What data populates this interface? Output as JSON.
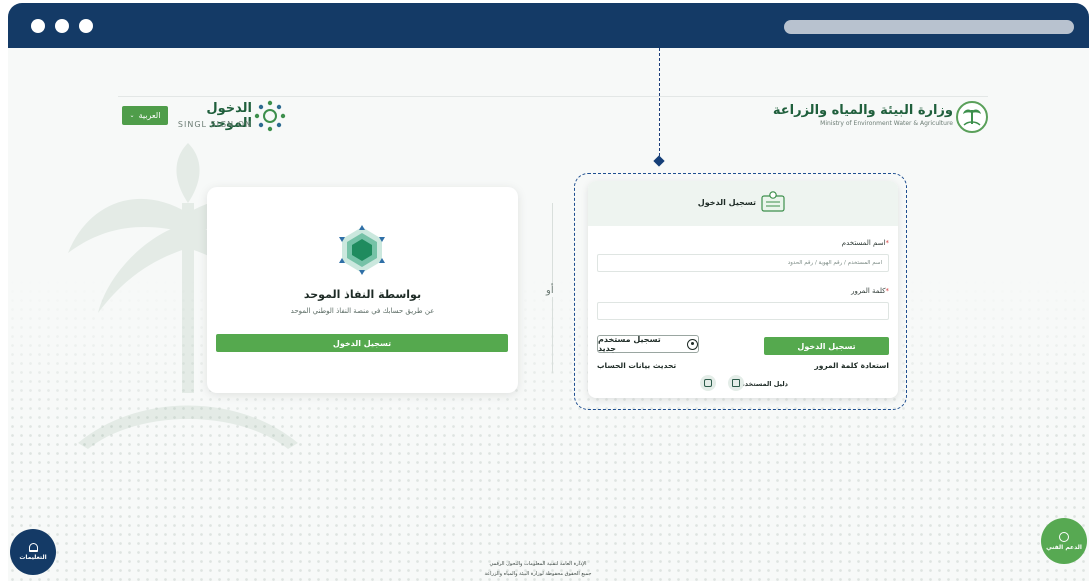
{
  "header": {
    "language_button": "العربية",
    "sso_title": "الدخول الموحد",
    "sso_subtitle": "SINGL SIGN ON",
    "ministry_title": "وزارة البيئة والمياه والزراعة",
    "ministry_subtitle": "Ministry of Environment Water & Agriculture"
  },
  "nafath": {
    "title": "بواسطة النفاذ الموحد",
    "subtitle": "عن طريق حسابك في منصة النفاذ الوطني الموحد",
    "login_button": "تسجيل الدخول"
  },
  "separator": {
    "or_text": "أو"
  },
  "login": {
    "title": "تسجيل الدخول",
    "username_label": "اسم المستخدم",
    "required_mark": "*",
    "username_placeholder": "اسم المستخدم / رقم الهوية / رقم الحدود",
    "password_label": "كلمة المرور",
    "login_button": "تسجيل الدخول",
    "register_button": "تسجيل مستخدم جديد",
    "forgot_password": "استعادة كلمة المرور",
    "update_account": "تحديث بيانات الحساب",
    "user_guide": "دليل المستخدم"
  },
  "floating": {
    "notifications_label": "التعليمات",
    "support_label": "الدعم الفني"
  },
  "footer": {
    "line1": "الإدارة العامة لتقنية المعلومات والتحول الرقمي",
    "line2": "جميع الحقوق محفوظة لوزارة البيئة والمياه والزراعة"
  },
  "colors": {
    "frame": "#143a66",
    "accent_green": "#55a94e",
    "dashed_highlight": "#1f4f90"
  }
}
